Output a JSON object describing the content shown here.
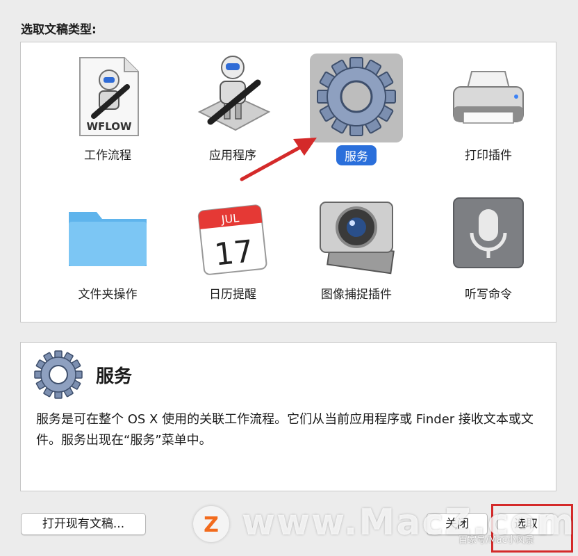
{
  "heading": "选取文稿类型:",
  "tiles": [
    {
      "label": "工作流程",
      "icon": "workflow-document-icon",
      "badge": "WFLOW"
    },
    {
      "label": "应用程序",
      "icon": "application-automator-icon"
    },
    {
      "label": "服务",
      "icon": "service-gear-icon",
      "selected": true
    },
    {
      "label": "打印插件",
      "icon": "printer-icon"
    },
    {
      "label": "文件夹操作",
      "icon": "folder-icon"
    },
    {
      "label": "日历提醒",
      "icon": "calendar-icon",
      "month": "JUL",
      "day": "17"
    },
    {
      "label": "图像捕捉插件",
      "icon": "image-capture-camera-icon"
    },
    {
      "label": "听写命令",
      "icon": "microphone-icon"
    }
  ],
  "description": {
    "title": "服务",
    "body": "服务是可在整个 OS X 使用的关联工作流程。它们从当前应用程序或 Finder 接收文本或文件。服务出现在“服务”菜单中。"
  },
  "buttons": {
    "open_existing": "打开现有文稿...",
    "close": "关闭",
    "choose": "选取"
  },
  "watermark": {
    "logo_letter": "Z",
    "text": "www.MacZ.com",
    "sub": "百家号/Mac小风景"
  },
  "colors": {
    "selection": "#2a6fdb",
    "annotation_red": "#d42a2a"
  }
}
